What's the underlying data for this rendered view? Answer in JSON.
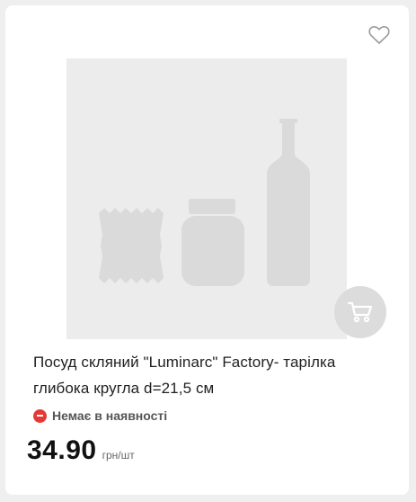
{
  "product": {
    "title": "Посуд скляний \"Luminarc\" Factory- тарілка глибока кругла d=21,5 см",
    "image_placeholder": "product-placeholder-icon",
    "availability": "Немає в наявності",
    "price": "34.90",
    "price_unit": "грн/шт"
  },
  "icons": {
    "favorite": "heart-outline-icon",
    "cart": "shopping-cart-icon",
    "availability": "minus-circle-icon"
  },
  "colors": {
    "availability_red": "#e53935",
    "placeholder_bg": "#ececec",
    "placeholder_shapes": "#dadada",
    "cart_button_bg": "#dcdcdc"
  }
}
